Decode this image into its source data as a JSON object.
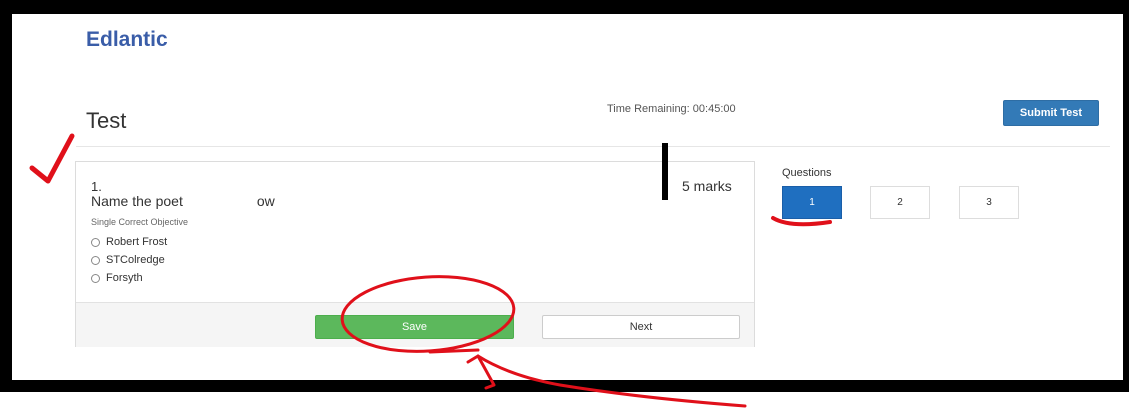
{
  "brand": {
    "logo_text": "Edlantic"
  },
  "header": {
    "page_title": "Test",
    "time_remaining": "Time Remaining: 00:45:00",
    "submit_label": "Submit Test"
  },
  "question": {
    "number": "1.",
    "text_start": "Name the poet",
    "text_end": "ow",
    "marks": "5 marks",
    "type": "Single Correct Objective",
    "options": [
      {
        "label": "Robert Frost"
      },
      {
        "label": "STColredge"
      },
      {
        "label": "Forsyth"
      }
    ],
    "save_label": "Save",
    "next_label": "Next"
  },
  "question_nav": {
    "title": "Questions",
    "items": [
      {
        "label": "1",
        "active": true
      },
      {
        "label": "2",
        "active": false
      },
      {
        "label": "3",
        "active": false
      }
    ]
  },
  "colors": {
    "brand": "#3a5da8",
    "primary": "#337ab7",
    "success": "#5cb85c",
    "active_nav": "#1f6fc0",
    "annotation": "#e0101a"
  }
}
